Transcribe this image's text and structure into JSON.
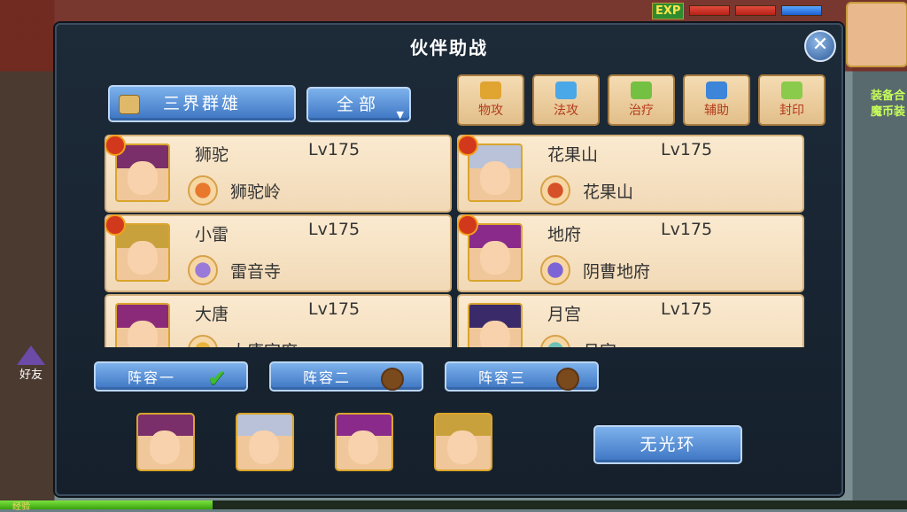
{
  "hud": {
    "exp_label": "EXP",
    "friends_label": "好友",
    "right_notice_line1": "装备合",
    "right_notice_line2": "魔币装",
    "xp_label": "经验"
  },
  "panel": {
    "title": "伙伴助战",
    "close_glyph": "✕"
  },
  "filters": {
    "faction_label": "三界群雄",
    "scope_label": "全部",
    "scope_arrow": "▼"
  },
  "roles": [
    {
      "label": "物攻",
      "color": "#e0a431"
    },
    {
      "label": "法攻",
      "color": "#4aa7e8"
    },
    {
      "label": "治疗",
      "color": "#74c043"
    },
    {
      "label": "辅助",
      "color": "#3c85d8"
    },
    {
      "label": "封印",
      "color": "#8acb4c"
    }
  ],
  "partners": [
    {
      "name": "狮驼",
      "level": "Lv175",
      "school": "狮驼岭",
      "hair": "#7b2f6a",
      "school_color": "#e8782c",
      "badge": true
    },
    {
      "name": "花果山",
      "level": "Lv175",
      "school": "花果山",
      "hair": "#b9c2d8",
      "school_color": "#d6502a",
      "badge": true
    },
    {
      "name": "小雷",
      "level": "Lv175",
      "school": "雷音寺",
      "hair": "#c9a13c",
      "school_color": "#9a7ad8",
      "badge": true
    },
    {
      "name": "地府",
      "level": "Lv175",
      "school": "阴曹地府",
      "hair": "#8a2a8a",
      "school_color": "#7c64d6",
      "badge": true
    },
    {
      "name": "大唐",
      "level": "Lv175",
      "school": "大唐官府",
      "hair": "#8c2a7a",
      "school_color": "#e7b33a",
      "badge": false
    },
    {
      "name": "月宫",
      "level": "Lv175",
      "school": "月宫",
      "hair": "#3a2a6a",
      "school_color": "#6cc0b8",
      "badge": false
    }
  ],
  "formations": [
    {
      "label": "阵容一",
      "selected": true,
      "check": "✔"
    },
    {
      "label": "阵容二",
      "selected": false
    },
    {
      "label": "阵容三",
      "selected": false
    }
  ],
  "team": [
    {
      "hair": "#7b2f6a"
    },
    {
      "hair": "#b9c2d8"
    },
    {
      "hair": "#8a2a8a"
    },
    {
      "hair": "#c9a13c"
    }
  ],
  "halo_button": "无光环"
}
